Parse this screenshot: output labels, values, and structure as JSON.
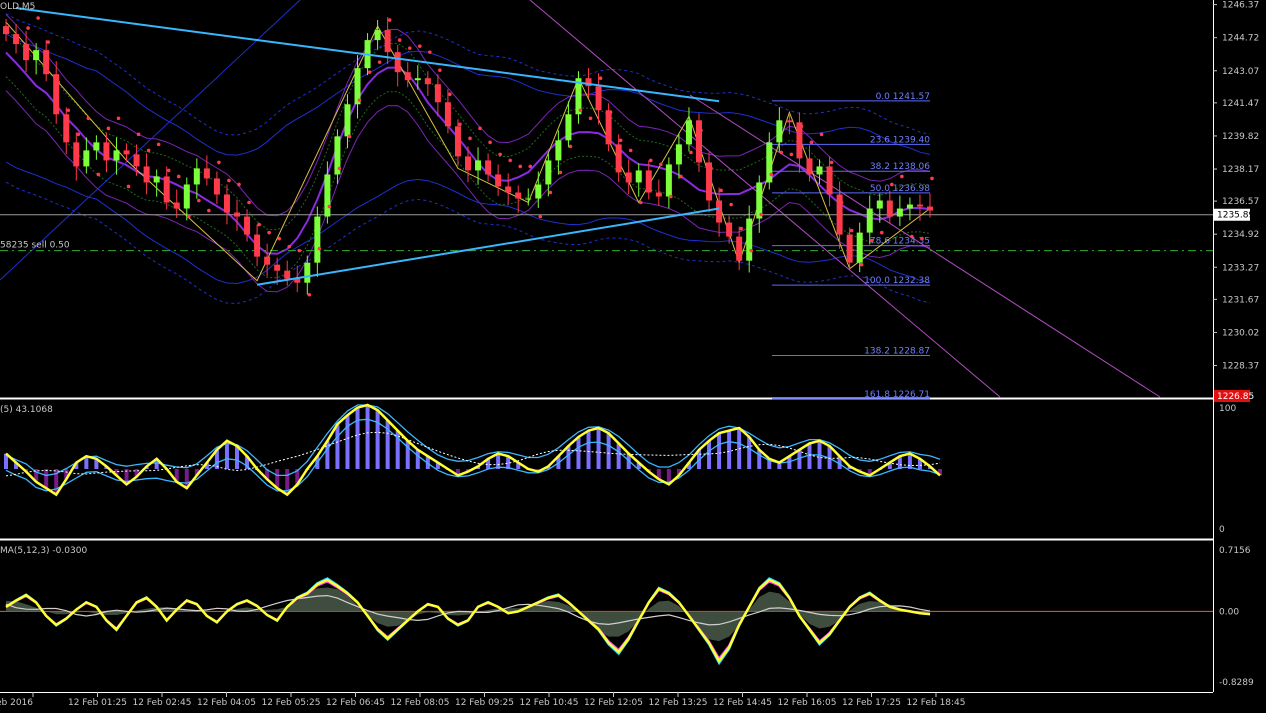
{
  "chart_data": [
    {
      "type": "line",
      "panel": "price",
      "title_fragment": "OLD,M5",
      "y_ticks": [
        "1246.37",
        "1244.72",
        "1243.07",
        "1241.47",
        "1239.82",
        "1238.17",
        "1236.57",
        "1234.92",
        "1233.27",
        "1231.67",
        "1230.02",
        "1228.37"
      ],
      "ylim": [
        1226.8,
        1246.6
      ],
      "current_price": "1235.89",
      "red_price_tag": "1226.85",
      "order_label": "58235 sell 0.50",
      "order_price": 1234.1,
      "fibonacci_levels": [
        {
          "label": "0.0 1241.57",
          "price": 1241.57
        },
        {
          "label": "23.6 1239.40",
          "price": 1239.4
        },
        {
          "label": "38.2 1238.06",
          "price": 1238.06
        },
        {
          "label": "50.0 1236.98",
          "price": 1236.98
        },
        {
          "label": "78.6 1234.35",
          "price": 1234.35
        },
        {
          "label": "100.0 1232.38",
          "price": 1232.38
        },
        {
          "label": "138.2 1228.87",
          "price": 1228.87
        },
        {
          "label": "161.8 1226.71",
          "price": 1226.71
        }
      ],
      "close_series": [
        1244.9,
        1244.4,
        1243.6,
        1244.1,
        1242.9,
        1240.9,
        1239.5,
        1238.3,
        1239.1,
        1239.5,
        1238.6,
        1239.1,
        1238.9,
        1238.3,
        1237.5,
        1237.8,
        1236.5,
        1236.2,
        1237.4,
        1238.2,
        1237.7,
        1236.9,
        1236.0,
        1235.8,
        1234.9,
        1233.8,
        1233.4,
        1233.1,
        1232.7,
        1232.5,
        1233.5,
        1235.8,
        1237.9,
        1239.8,
        1241.4,
        1243.2,
        1244.6,
        1245.1,
        1244.0,
        1243.0,
        1242.6,
        1242.7,
        1242.4,
        1241.5,
        1240.3,
        1238.8,
        1238.1,
        1238.6,
        1237.9,
        1237.3,
        1237.0,
        1236.7,
        1236.7,
        1237.4,
        1238.6,
        1239.6,
        1240.9,
        1242.7,
        1242.3,
        1241.1,
        1239.4,
        1238.0,
        1237.5,
        1238.1,
        1237.0,
        1236.8,
        1238.4,
        1239.4,
        1240.6,
        1238.5,
        1236.6,
        1235.5,
        1234.8,
        1233.6,
        1235.7,
        1237.5,
        1239.5,
        1240.6,
        1240.5,
        1238.7,
        1237.9,
        1238.3,
        1236.9,
        1234.9,
        1233.5,
        1235.0,
        1236.2,
        1236.6,
        1235.8,
        1236.2,
        1236.4,
        1236.3,
        1236.1
      ],
      "upper_trendline": [
        [
          1,
          1246.2
        ],
        [
          33,
          1242.9
        ],
        [
          71,
          1241.55
        ]
      ],
      "lower_trendline": [
        [
          25,
          1232.4
        ],
        [
          61,
          1235.9
        ],
        [
          71,
          1236.2
        ]
      ]
    },
    {
      "type": "bar",
      "panel": "stochastic_oscillator",
      "header": "(5) 43.1068",
      "y_ticks": [
        "100",
        "0"
      ],
      "ylim": [
        0,
        100
      ],
      "main_line": [
        62,
        55,
        48,
        40,
        35,
        30,
        42,
        55,
        60,
        58,
        52,
        45,
        38,
        44,
        52,
        58,
        50,
        40,
        35,
        45,
        55,
        65,
        72,
        68,
        60,
        50,
        42,
        35,
        30,
        38,
        50,
        60,
        72,
        85,
        92,
        98,
        100,
        96,
        88,
        80,
        72,
        65,
        60,
        55,
        50,
        45,
        48,
        52,
        58,
        62,
        60,
        55,
        50,
        48,
        52,
        60,
        68,
        75,
        80,
        82,
        78,
        70,
        62,
        55,
        48,
        42,
        38,
        45,
        55,
        65,
        72,
        78,
        80,
        82,
        75,
        65,
        58,
        55,
        60,
        65,
        70,
        72,
        68,
        60,
        52,
        48,
        45,
        50,
        55,
        60,
        62,
        58,
        52,
        45
      ]
    },
    {
      "type": "area",
      "panel": "macd",
      "header": "MA(5,12,3) -0.0300",
      "y_ticks": [
        "0.7156",
        "0.00",
        "-0.8289"
      ],
      "ylim": [
        -0.8289,
        0.7156
      ],
      "main_line": [
        0.05,
        0.12,
        0.18,
        0.1,
        -0.05,
        -0.15,
        -0.08,
        0.02,
        0.1,
        0.05,
        -0.1,
        -0.2,
        -0.05,
        0.1,
        0.15,
        0.05,
        -0.1,
        0.02,
        0.12,
        0.08,
        -0.05,
        -0.12,
        0.0,
        0.08,
        0.12,
        0.06,
        -0.04,
        -0.1,
        0.05,
        0.15,
        0.2,
        0.3,
        0.35,
        0.28,
        0.2,
        0.1,
        -0.05,
        -0.2,
        -0.3,
        -0.2,
        -0.1,
        0.0,
        0.08,
        0.05,
        -0.08,
        -0.15,
        -0.1,
        0.05,
        0.1,
        0.05,
        -0.02,
        0.0,
        0.05,
        0.1,
        0.15,
        0.18,
        0.1,
        0.0,
        -0.1,
        -0.2,
        -0.35,
        -0.45,
        -0.3,
        -0.1,
        0.1,
        0.25,
        0.2,
        0.1,
        -0.05,
        -0.2,
        -0.35,
        -0.55,
        -0.4,
        -0.15,
        0.05,
        0.25,
        0.35,
        0.3,
        0.15,
        -0.05,
        -0.2,
        -0.35,
        -0.25,
        -0.1,
        0.05,
        0.15,
        0.2,
        0.12,
        0.05,
        0.02,
        0.0,
        -0.02,
        -0.03
      ]
    }
  ],
  "x_axis": {
    "labels": [
      "eb 2016",
      "12 Feb 01:25",
      "12 Feb 02:45",
      "12 Feb 04:05",
      "12 Feb 05:25",
      "12 Feb 06:45",
      "12 Feb 08:05",
      "12 Feb 09:25",
      "12 Feb 10:45",
      "12 Feb 12:05",
      "12 Feb 13:25",
      "12 Feb 14:45",
      "12 Feb 16:05",
      "12 Feb 17:25",
      "12 Feb 18:45"
    ]
  },
  "colors": {
    "background": "#000000",
    "bull_candle": "#7cff3a",
    "bear_candle": "#ff3a4a",
    "trendline": "#3ab6ff",
    "fib": "#5a6bff",
    "parabolic_sar": "#ff3a4a",
    "stoch_main": "#ffff33",
    "stoch_signal": "#3ab6ff",
    "histogram_up": "#7a70ff",
    "histogram_down": "#7a1b8a",
    "macd_magenta": "#ff44ff",
    "macd_cyan": "#33ddff",
    "zero_line": "#ff5a1a",
    "price_tag_red": "#e01010",
    "price_tag_white": "#ffffff",
    "order_line": "#33aa33"
  }
}
